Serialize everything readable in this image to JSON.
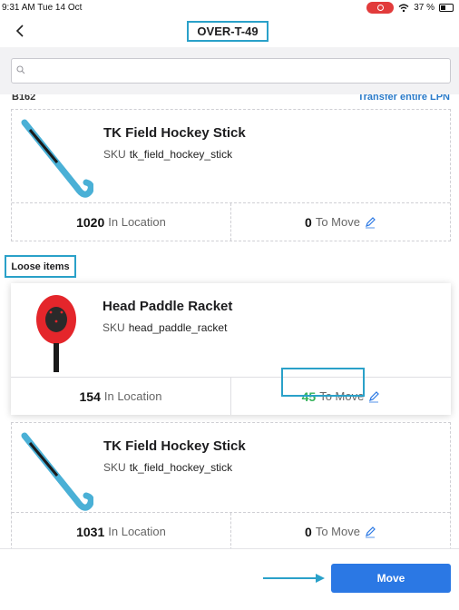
{
  "status_bar": {
    "time_date": "9:31 AM  Tue 14 Oct",
    "battery": "37 %"
  },
  "header": {
    "back_icon": "chevron-left-icon",
    "title": "OVER-T-49"
  },
  "search": {
    "placeholder": "",
    "value": ""
  },
  "partial_top": {
    "left_text": "B162",
    "right_link": "Transfer entire LPN"
  },
  "section_loose": {
    "label": "Loose items"
  },
  "items": [
    {
      "name": "TK Field Hockey Stick",
      "sku_label": "SKU",
      "sku": "tk_field_hockey_stick",
      "in_location_count": "1020",
      "in_location_label": "In Location",
      "to_move_count": "0",
      "to_move_label": "To Move",
      "icon": "hockey-stick-image"
    },
    {
      "name": "Head Paddle Racket",
      "sku_label": "SKU",
      "sku": "head_paddle_racket",
      "in_location_count": "154",
      "in_location_label": "In Location",
      "to_move_count": "45",
      "to_move_label": "To Move",
      "icon": "paddle-racket-image"
    },
    {
      "name": "TK Field Hockey Stick",
      "sku_label": "SKU",
      "sku": "tk_field_hockey_stick",
      "in_location_count": "1031",
      "in_location_label": "In Location",
      "to_move_count": "0",
      "to_move_label": "To Move",
      "icon": "hockey-stick-image"
    }
  ],
  "footer": {
    "move_label": "Move"
  },
  "colors": {
    "accent_blue": "#2b78e4",
    "highlight": "#2aa1c9",
    "green": "#34b25a"
  }
}
